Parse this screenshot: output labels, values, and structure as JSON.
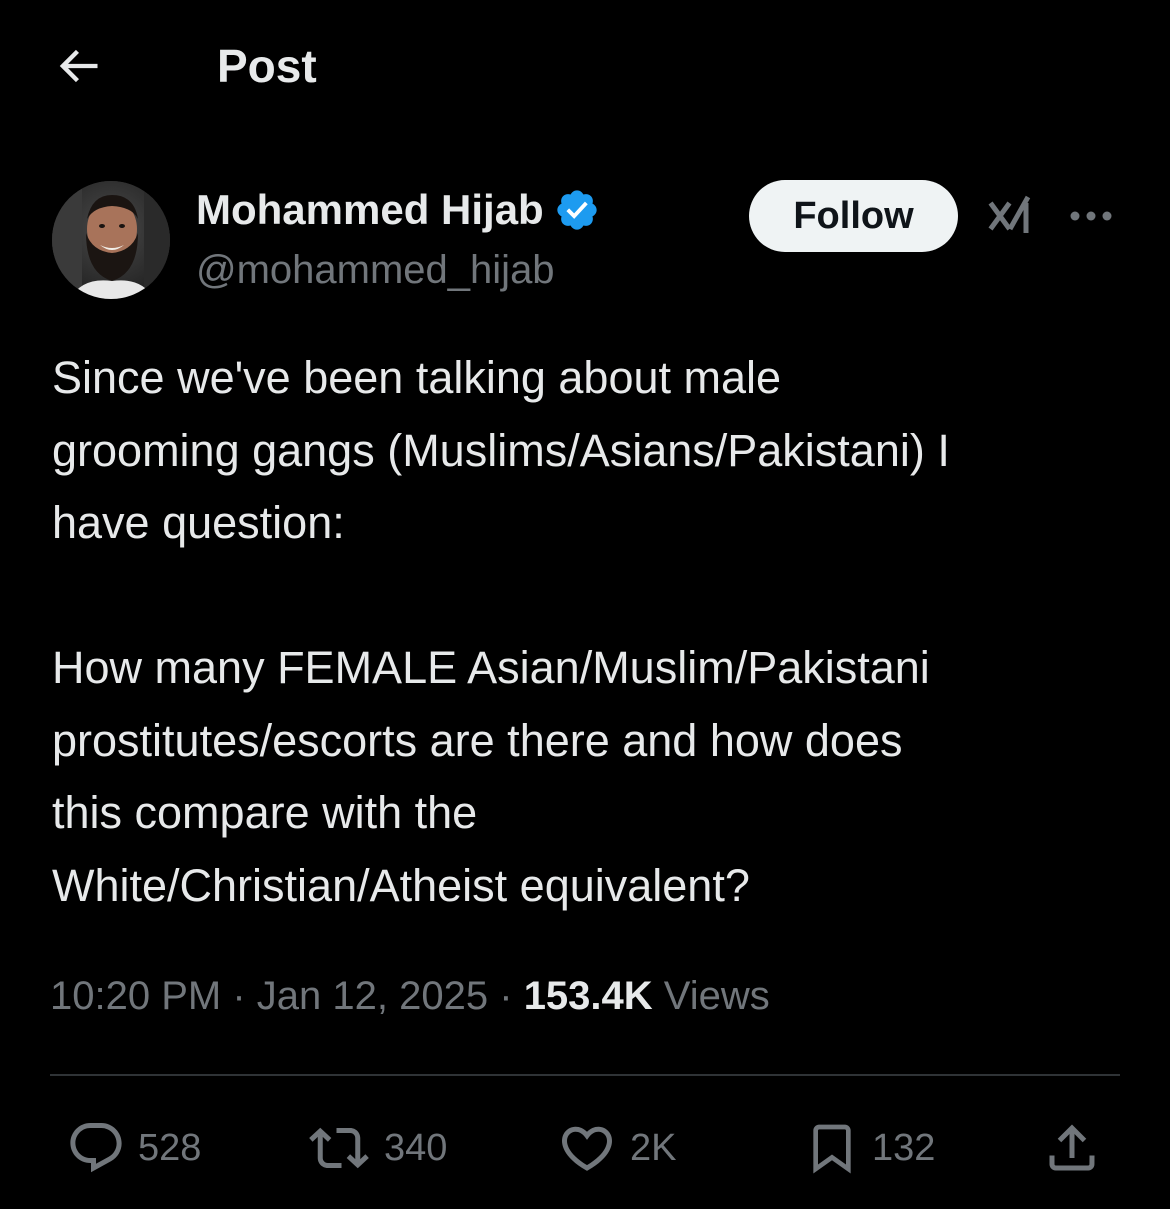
{
  "header": {
    "title": "Post"
  },
  "author": {
    "name": "Mohammed Hijab",
    "handle": "@mohammed_hijab",
    "verified": true
  },
  "actions_top": {
    "follow_label": "Follow"
  },
  "tweet": {
    "paragraphs": [
      [
        "Since we've been talking about male",
        "grooming gangs (Muslims/Asians/Pakistani) I",
        "have question:"
      ],
      [
        "How many FEMALE Asian/Muslim/Pakistani",
        "prostitutes/escorts are there and how does",
        "this compare with the",
        "White/Christian/Atheist equivalent?"
      ]
    ]
  },
  "meta": {
    "time": "10:20 PM",
    "separator": "·",
    "date": "Jan 12, 2025",
    "views_count": "153.4K",
    "views_label": "Views"
  },
  "engagement": {
    "replies": "528",
    "reposts": "340",
    "likes": "2K",
    "bookmarks": "132"
  },
  "icons": {
    "back": "arrow-left-icon",
    "verified": "verified-badge-icon",
    "grok": "grok-icon",
    "more": "more-horizontal-icon",
    "reply": "reply-bubble-icon",
    "repost": "repost-icon",
    "like": "heart-icon",
    "bookmark": "bookmark-icon",
    "share": "share-icon"
  },
  "colors": {
    "background": "#000000",
    "text_primary": "#e7e9ea",
    "text_secondary": "#71767b",
    "verified_blue": "#1d9bf0",
    "divider": "#2f3336",
    "follow_bg": "#eff3f4"
  }
}
